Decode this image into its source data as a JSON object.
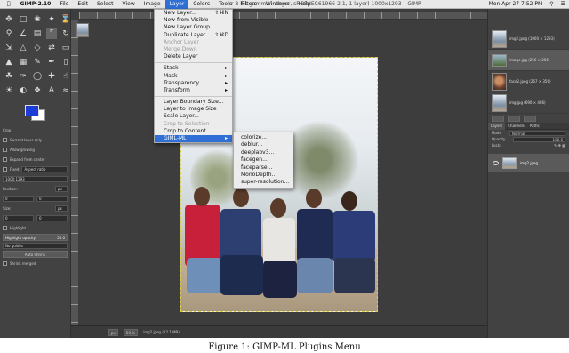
{
  "menubar": {
    "app": "GIMP-2.10",
    "items": [
      "File",
      "Edit",
      "Select",
      "View",
      "Image",
      "Layer",
      "Colors",
      "Tools",
      "Filters",
      "Windows",
      "Help"
    ],
    "active_index": 5,
    "window_title": "r 8-bit gamma integer, sRGB IEC61966-2.1, 1 layer) 1000x1293 – GIMP",
    "clock": "Mon Apr 27  7:52 PM"
  },
  "layer_menu": {
    "items": [
      {
        "label": "New Layer...",
        "shortcut": "⇧⌘N",
        "disabled": false,
        "submenu": false
      },
      {
        "label": "New from Visible",
        "shortcut": "",
        "disabled": false,
        "submenu": false
      },
      {
        "label": "New Layer Group",
        "shortcut": "",
        "disabled": false,
        "submenu": false
      },
      {
        "label": "Duplicate Layer",
        "shortcut": "⇧⌘D",
        "disabled": false,
        "submenu": false
      },
      {
        "label": "Anchor Layer",
        "shortcut": "",
        "disabled": true,
        "submenu": false
      },
      {
        "label": "Merge Down",
        "shortcut": "",
        "disabled": true,
        "submenu": false
      },
      {
        "label": "Delete Layer",
        "shortcut": "",
        "disabled": false,
        "submenu": false
      },
      {
        "sep": true
      },
      {
        "label": "Stack",
        "shortcut": "",
        "disabled": false,
        "submenu": true
      },
      {
        "label": "Mask",
        "shortcut": "",
        "disabled": false,
        "submenu": true
      },
      {
        "label": "Transparency",
        "shortcut": "",
        "disabled": false,
        "submenu": true
      },
      {
        "label": "Transform",
        "shortcut": "",
        "disabled": false,
        "submenu": true
      },
      {
        "sep": true
      },
      {
        "label": "Layer Boundary Size...",
        "shortcut": "",
        "disabled": false,
        "submenu": false
      },
      {
        "label": "Layer to Image Size",
        "shortcut": "",
        "disabled": false,
        "submenu": false
      },
      {
        "label": "Scale Layer...",
        "shortcut": "",
        "disabled": false,
        "submenu": false
      },
      {
        "label": "Crop to Selection",
        "shortcut": "",
        "disabled": true,
        "submenu": false
      },
      {
        "label": "Crop to Content",
        "shortcut": "",
        "disabled": false,
        "submenu": false
      },
      {
        "label": "GIML-ML",
        "shortcut": "",
        "disabled": false,
        "submenu": true,
        "highlighted": true
      }
    ]
  },
  "giml_submenu": {
    "items": [
      "colorize...",
      "deblur...",
      "deeplabv3...",
      "facegen...",
      "faceparse...",
      "MonoDepth...",
      "super-resolution..."
    ]
  },
  "tool_options": {
    "rows": [
      "Crop",
      "Current layer only",
      "Allow growing",
      "Expand from center"
    ],
    "fixed_label": "Fixed",
    "fixed_value": "Aspect ratio",
    "size_value": "1000:1293",
    "position_label": "Position:",
    "position_unit": "px",
    "position_x": "0",
    "position_y": "0",
    "size_label": "Size:",
    "size_x": "0",
    "size_y": "0",
    "highlight_label": "Highlight",
    "highlight_opacity_label": "Highlight opacity",
    "highlight_opacity_value": "50.0",
    "guides": "No guides",
    "auto_shrink": "Auto Shrink",
    "shrink_merged": "Shrink merged"
  },
  "status": {
    "unit": "px",
    "zoom": "50 %",
    "file": "img2.jpeg (12.1 MB)"
  },
  "images_panel": {
    "items": [
      {
        "label": "img2.jpeg (1000 × 1293)",
        "type": "photo",
        "selected": false
      },
      {
        "label": "image.jpg (256 × 256)",
        "type": "land",
        "selected": true
      },
      {
        "label": "face2.jpeg (267 × 356)",
        "type": "face",
        "selected": false
      },
      {
        "label": "img.jpg (690 × 406)",
        "type": "photo",
        "selected": false
      }
    ]
  },
  "layers_panel": {
    "tabs": [
      "Layers",
      "Channels",
      "Paths"
    ],
    "mode_label": "Mode",
    "mode_value": "Normal",
    "opacity_label": "Opacity",
    "opacity_value": "100.0",
    "lock_label": "Lock:",
    "layer_name": "img2.jpeg"
  },
  "caption": "Figure 1: GIMP-ML Plugins Menu",
  "colors": {
    "accent": "#2f6fd6",
    "foreground": "#1b3cd6",
    "background": "#ffffff",
    "selection_outline": "#d8cf4a"
  }
}
